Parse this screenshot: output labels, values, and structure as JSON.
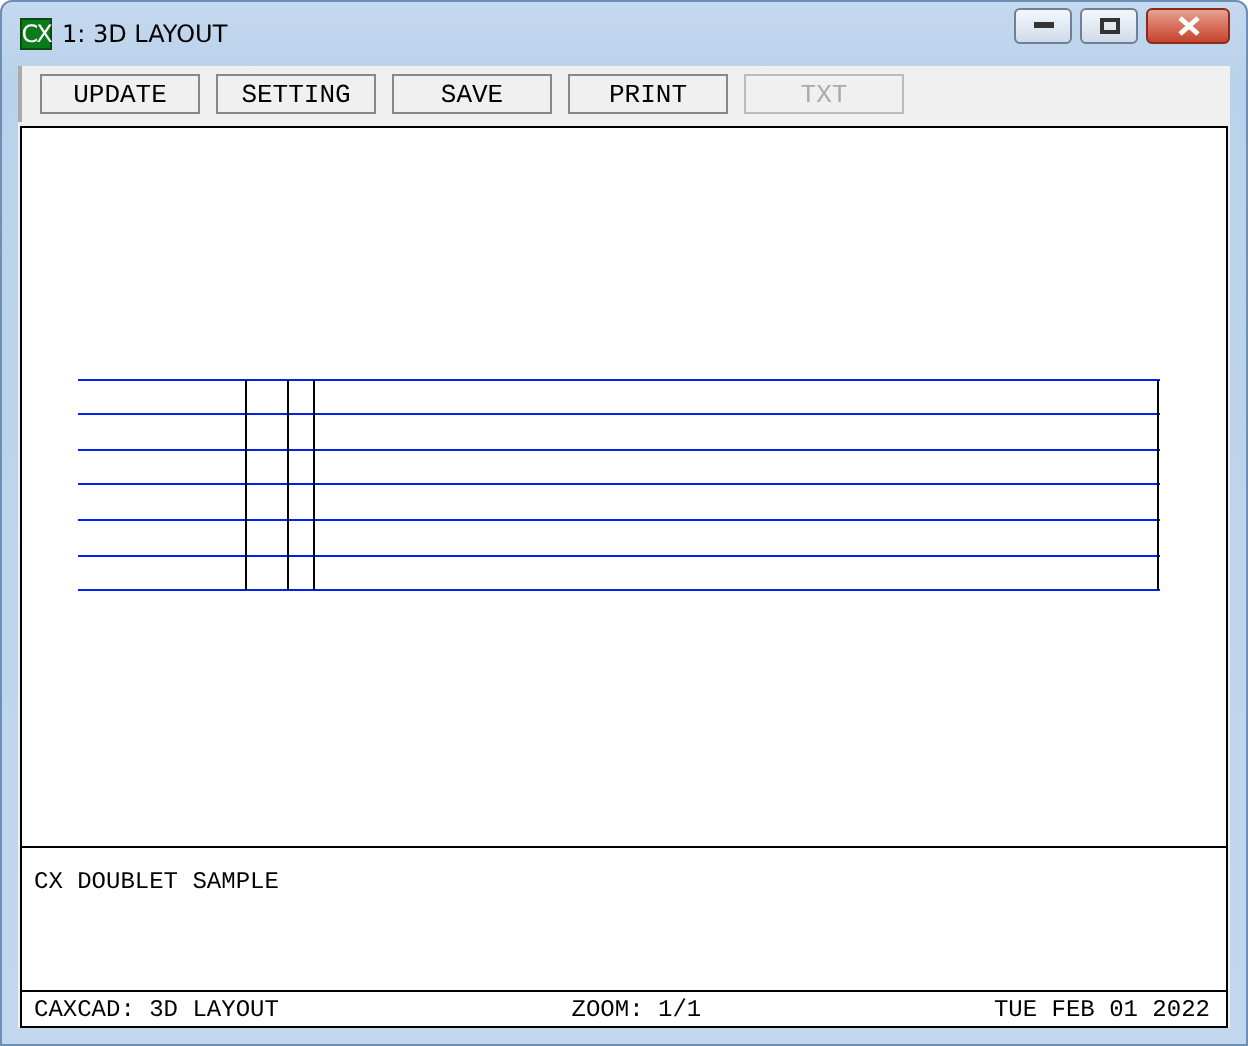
{
  "window": {
    "app_icon": "CX",
    "title": "1: 3D LAYOUT"
  },
  "toolbar": [
    {
      "label": "UPDATE",
      "disabled": false
    },
    {
      "label": "SETTING",
      "disabled": false
    },
    {
      "label": "SAVE",
      "disabled": false
    },
    {
      "label": "PRINT",
      "disabled": false
    },
    {
      "label": "TXT",
      "disabled": true
    }
  ],
  "text_panel": {
    "text": "CX DOUBLET SAMPLE"
  },
  "status_bar": {
    "left": "CAXCAD: 3D LAYOUT",
    "center": "ZOOM: 1/1",
    "right": "TUE FEB 01 2022"
  }
}
